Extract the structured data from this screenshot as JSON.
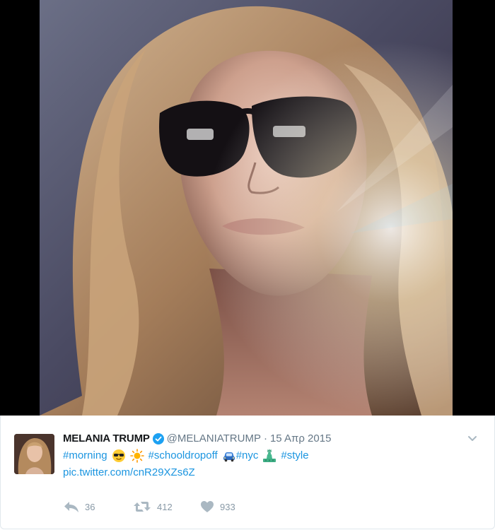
{
  "tweet": {
    "display_name": "MELANIA TRUMP",
    "handle": "@MELANIATRUMP",
    "separator": "·",
    "date": "15 Απρ 2015",
    "verified_icon": "verified-badge-icon",
    "line1": {
      "tag_morning": "#morning",
      "tag_schooldropoff": "#schooldropoff",
      "tag_nyc": "#nyc",
      "tag_style": "#style"
    },
    "pic_link": "pic.twitter.com/cnR29XZs6Z",
    "emojis": [
      "sunglasses-emoji",
      "sun-emoji",
      "car-emoji",
      "statue-of-liberty-emoji"
    ]
  },
  "actions": {
    "reply_count": "36",
    "retweet_count": "412",
    "like_count": "933"
  },
  "colors": {
    "link": "#1b95e0",
    "name": "#14171a",
    "meta": "#657786",
    "action_icon": "#aab8c2",
    "verified": "#1da1f2"
  }
}
